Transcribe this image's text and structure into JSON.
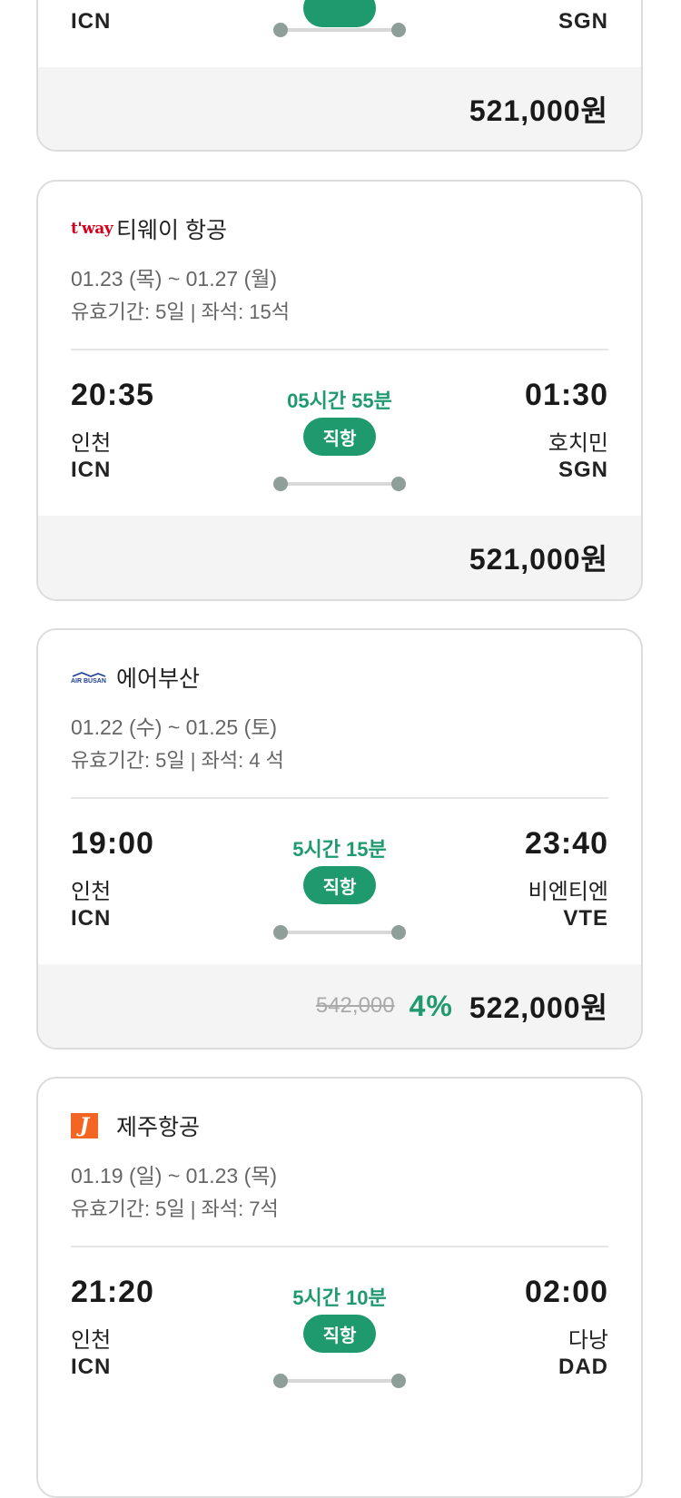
{
  "cards": [
    {
      "dep_code": "ICN",
      "arr_code": "SGN",
      "price": "521,000원"
    },
    {
      "airline": "티웨이 항공",
      "logo_text": "t'way",
      "dates": "01.23 (목) ~ 01.27 (월)",
      "validity": "유효기간: 5일 | 좌석: 15석",
      "dep_time": "20:35",
      "dep_city": "인천",
      "dep_code": "ICN",
      "duration": "05시간 55분",
      "badge": "직항",
      "arr_time": "01:30",
      "arr_city": "호치민",
      "arr_code": "SGN",
      "price": "521,000원"
    },
    {
      "airline": "에어부산",
      "logo_text": "AIR BUSAN",
      "dates": "01.22 (수) ~ 01.25 (토)",
      "validity": "유효기간: 5일 | 좌석: 4 석",
      "dep_time": "19:00",
      "dep_city": "인천",
      "dep_code": "ICN",
      "duration": "5시간 15분",
      "badge": "직항",
      "arr_time": "23:40",
      "arr_city": "비엔티엔",
      "arr_code": "VTE",
      "original_price": "542,000",
      "discount": "4%",
      "price": "522,000원"
    },
    {
      "airline": "제주항공",
      "logo_text": "J",
      "dates": "01.19 (일) ~ 01.23 (목)",
      "validity": "유효기간: 5일 | 좌석: 7석",
      "dep_time": "21:20",
      "dep_city": "인천",
      "dep_code": "ICN",
      "duration": "5시간 10분",
      "badge": "직항",
      "arr_time": "02:00",
      "arr_city": "다낭",
      "arr_code": "DAD"
    }
  ],
  "colors": {
    "accent": "#1f9a6f",
    "tway_red": "#d6001c",
    "airbusan_navy": "#1d3f8f",
    "jeju_orange": "#f26522"
  }
}
